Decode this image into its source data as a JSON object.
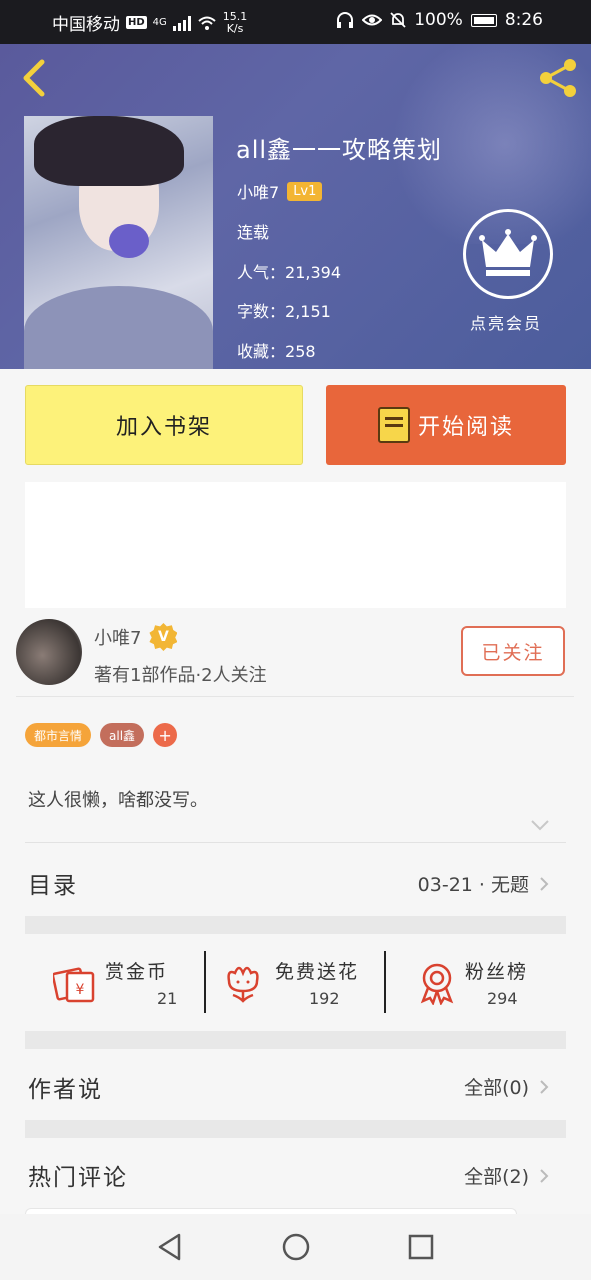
{
  "status_bar": {
    "carrier": "中国移动",
    "hd": "HD",
    "network": "4G",
    "speed_value": "15.1",
    "speed_unit": "K/s",
    "battery": "100%",
    "time": "8:26"
  },
  "book": {
    "title": "all鑫一一攻略策划",
    "author": "小唯7",
    "level": "Lv1",
    "status": "连载",
    "popularity_label": "人气：",
    "popularity": "21,394",
    "words_label": "字数：",
    "words": "2,151",
    "favorites_label": "收藏：",
    "favorites": "258",
    "vip_label": "点亮会员"
  },
  "actions": {
    "add_shelf": "加入书架",
    "start_read": "开始阅读"
  },
  "author_card": {
    "name": "小唯7",
    "verified_badge": "V",
    "stats": "著有1部作品·2人关注",
    "follow_label": "已关注"
  },
  "tags": [
    "都市言情",
    "all鑫"
  ],
  "tag_add": "+",
  "description": "这人很懒，啥都没写。",
  "toc": {
    "title": "目录",
    "latest": "03-21 · 无题"
  },
  "stats": [
    {
      "icon": "reward-coin-icon",
      "label": "赏金币",
      "value": "21"
    },
    {
      "icon": "flower-icon",
      "label": "免费送花",
      "value": "192"
    },
    {
      "icon": "fan-rank-icon",
      "label": "粉丝榜",
      "value": "294"
    }
  ],
  "author_says": {
    "title": "作者说",
    "count_label": "全部(0)"
  },
  "hot_comments": {
    "title": "热门评论",
    "count_label": "全部(2)"
  },
  "colors": {
    "accent_orange": "#e8663b",
    "shelf_yellow": "#fdf27a",
    "level_badge": "#f3b533",
    "icon_red": "#d9422f"
  }
}
